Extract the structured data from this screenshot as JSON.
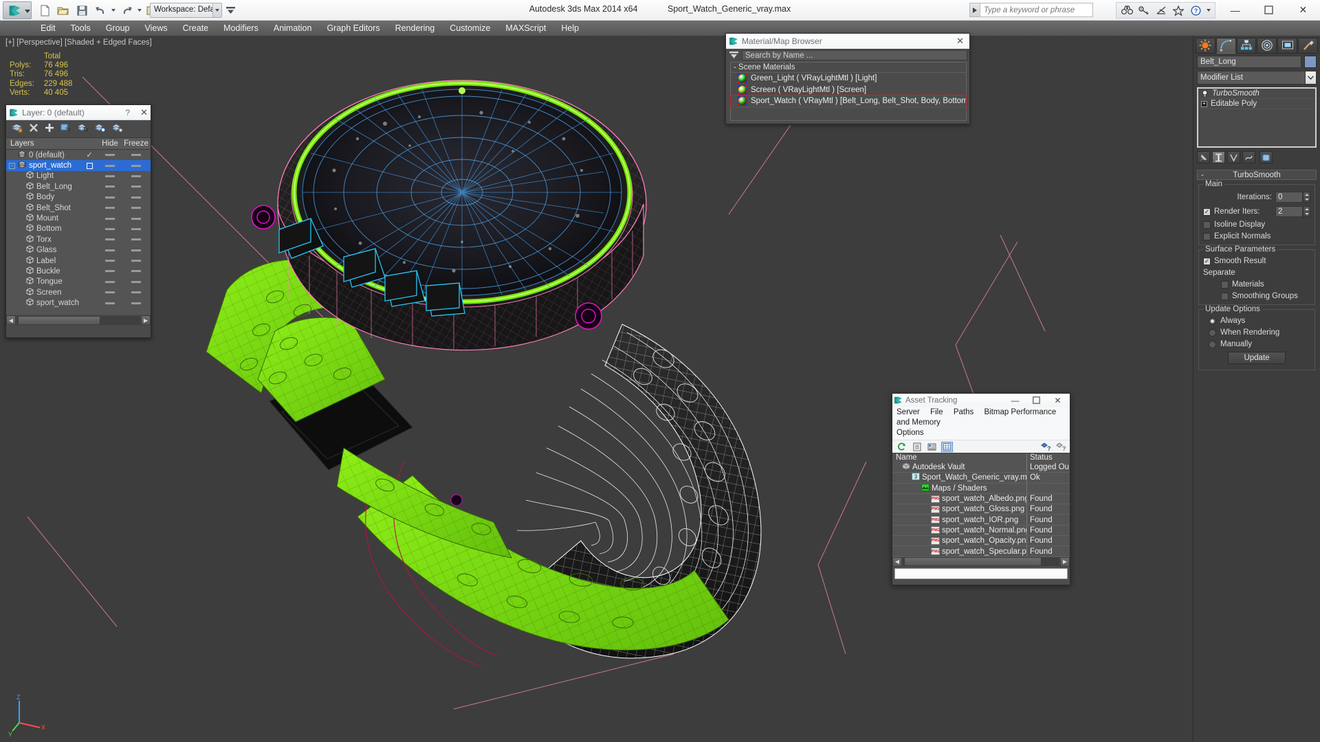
{
  "titlebar": {
    "workspace": "Workspace: Default",
    "app_title": "Autodesk 3ds Max  2014 x64",
    "file_title": "Sport_Watch_Generic_vray.max",
    "search_placeholder": "Type a keyword or phrase",
    "quick_access": [
      "new-icon",
      "open-icon",
      "save-icon",
      "undo-icon",
      "redo-icon",
      "set-project-folder-icon"
    ],
    "right_tools": [
      "binoculars-icon",
      "key-icon",
      "satellite-dish-icon",
      "star-icon",
      "help-icon"
    ],
    "window_controls": {
      "minimize": "—",
      "maximize": "☐",
      "close": "✕"
    }
  },
  "menubar": {
    "items": [
      "Edit",
      "Tools",
      "Group",
      "Views",
      "Create",
      "Modifiers",
      "Animation",
      "Graph Editors",
      "Rendering",
      "Customize",
      "MAXScript",
      "Help"
    ]
  },
  "viewport": {
    "label": "[+] [Perspective] [Shaded + Edged Faces]",
    "stats": {
      "col_header": "Total",
      "rows": [
        {
          "label": "Polys:",
          "value": "76 496"
        },
        {
          "label": "Tris:",
          "value": "76 496"
        },
        {
          "label": "Edges:",
          "value": "229 488"
        },
        {
          "label": "Verts:",
          "value": "40 405"
        }
      ]
    },
    "axis_labels": {
      "x": "X",
      "y": "Y",
      "z": "Z"
    }
  },
  "layer_dialog": {
    "title": "Layer: 0 (default)",
    "help": "?",
    "close": "✕",
    "toolbar_icons": [
      "create-new-layer-icon",
      "delete-layer-icon",
      "add-layer-icon",
      "select-objects-in-layer-icon",
      "select-highlighted-objects-icon",
      "highlight-selected-objects-icon",
      "layer-properties-icon"
    ],
    "columns": {
      "layers": "Layers",
      "hide": "Hide",
      "freeze": "Freeze"
    },
    "rows": [
      {
        "name": "0 (default)",
        "indent": 0,
        "icon": "layer-icon",
        "state": "check",
        "selected": false
      },
      {
        "name": "sport_watch",
        "indent": 0,
        "icon": "layer-icon",
        "state": "box",
        "selected": true,
        "expander": "-"
      },
      {
        "name": "Light",
        "indent": 1,
        "icon": "object-icon",
        "state": "",
        "selected": false
      },
      {
        "name": "Belt_Long",
        "indent": 1,
        "icon": "object-icon",
        "state": "",
        "selected": false
      },
      {
        "name": "Body",
        "indent": 1,
        "icon": "object-icon",
        "state": "",
        "selected": false
      },
      {
        "name": "Belt_Shot",
        "indent": 1,
        "icon": "object-icon",
        "state": "",
        "selected": false
      },
      {
        "name": "Mount",
        "indent": 1,
        "icon": "object-icon",
        "state": "",
        "selected": false
      },
      {
        "name": "Bottom",
        "indent": 1,
        "icon": "object-icon",
        "state": "",
        "selected": false
      },
      {
        "name": "Torx",
        "indent": 1,
        "icon": "object-icon",
        "state": "",
        "selected": false
      },
      {
        "name": "Glass",
        "indent": 1,
        "icon": "object-icon",
        "state": "",
        "selected": false
      },
      {
        "name": "Label",
        "indent": 1,
        "icon": "object-icon",
        "state": "",
        "selected": false
      },
      {
        "name": "Buckle",
        "indent": 1,
        "icon": "object-icon",
        "state": "",
        "selected": false
      },
      {
        "name": "Tongue",
        "indent": 1,
        "icon": "object-icon",
        "state": "",
        "selected": false
      },
      {
        "name": "Screen",
        "indent": 1,
        "icon": "object-icon",
        "state": "",
        "selected": false
      },
      {
        "name": "sport_watch",
        "indent": 1,
        "icon": "object-icon",
        "state": "",
        "selected": false
      }
    ]
  },
  "material_browser": {
    "title": "Material/Map Browser",
    "close": "✕",
    "search_value": "Search by Name ...",
    "group": "-  Scene Materials",
    "materials": [
      {
        "name": "Green_Light  ( VRayLightMtl )  [Light]",
        "color": "#22e022",
        "selected": false
      },
      {
        "name": "Screen  ( VRayLightMtl )  [Screen]",
        "color": "#8ee622",
        "selected": false
      },
      {
        "name": "Sport_Watch  ( VRayMtl )  [Belt_Long, Belt_Shot, Body, Bottom, Buckle,..",
        "color": "#56c41e",
        "selected": true
      }
    ]
  },
  "command_panel": {
    "tabs": [
      "create-tab-icon",
      "modify-tab-icon",
      "hierarchy-tab-icon",
      "motion-tab-icon",
      "display-tab-icon",
      "utilities-tab-icon"
    ],
    "active_tab_index": 1,
    "object_name": "Belt_Long",
    "object_color": "#7d98c4",
    "modifier_list_label": "Modifier List",
    "stack": [
      {
        "label": "TurboSmooth",
        "italic": true,
        "icon": "lightbulb-icon"
      },
      {
        "label": "Editable Poly",
        "italic": false,
        "icon": "plus-box-icon"
      }
    ],
    "stack_tools": [
      "pin-stack-icon",
      "show-end-result-icon",
      "make-unique-icon",
      "remove-modifier-icon",
      "configure-modifier-sets-icon"
    ],
    "rollout": {
      "title": "TurboSmooth",
      "minus": "-",
      "main": {
        "legend": "Main",
        "iterations_label": "Iterations:",
        "iterations_value": "0",
        "render_iters_label": "Render Iters:",
        "render_iters_value": "2",
        "render_iters_checked": true,
        "isoline_label": "Isoline Display",
        "isoline_checked": false,
        "explicit_label": "Explicit Normals",
        "explicit_checked": false
      },
      "surface": {
        "legend": "Surface Parameters",
        "smooth_result_label": "Smooth Result",
        "smooth_result_checked": true,
        "separate_label": "Separate",
        "materials_label": "Materials",
        "materials_checked": false,
        "smoothing_groups_label": "Smoothing Groups",
        "smoothing_groups_checked": false
      },
      "update": {
        "legend": "Update Options",
        "options": [
          "Always",
          "When Rendering",
          "Manually"
        ],
        "selected_index": 0,
        "button": "Update"
      }
    }
  },
  "asset_tracking": {
    "title": "Asset Tracking",
    "window_controls": {
      "minimize": "—",
      "maximize": "☐",
      "close": "✕"
    },
    "menu": [
      "Server",
      "File",
      "Paths",
      "Bitmap Performance and Memory",
      "Options"
    ],
    "toolbar_icons": [
      "refresh-icon",
      "list-view-icon",
      "detail-view-icon",
      "grid-view-icon",
      "add-help-icon",
      "help-icon"
    ],
    "columns": {
      "name": "Name",
      "status": "Status"
    },
    "rows": [
      {
        "name": "Autodesk Vault",
        "indent": 1,
        "icon": "vault-icon",
        "status": "Logged Ou"
      },
      {
        "name": "Sport_Watch_Generic_vray.max",
        "indent": 2,
        "icon": "max-file-icon",
        "status": "Ok"
      },
      {
        "name": "Maps / Shaders",
        "indent": 3,
        "icon": "maps-icon",
        "status": ""
      },
      {
        "name": "sport_watch_Albedo.png",
        "indent": 4,
        "icon": "png-icon",
        "status": "Found"
      },
      {
        "name": "sport_watch_Gloss.png",
        "indent": 4,
        "icon": "png-icon",
        "status": "Found"
      },
      {
        "name": "sport_watch_IOR.png",
        "indent": 4,
        "icon": "png-icon",
        "status": "Found"
      },
      {
        "name": "sport_watch_Normal.png",
        "indent": 4,
        "icon": "png-icon",
        "status": "Found"
      },
      {
        "name": "sport_watch_Opacity.png",
        "indent": 4,
        "icon": "png-icon",
        "status": "Found"
      },
      {
        "name": "sport_watch_Specular.png",
        "indent": 4,
        "icon": "png-icon",
        "status": "Found"
      }
    ]
  },
  "colors": {
    "accent_green": "#7cf000",
    "wire_white": "#ffffff",
    "wire_pink": "#ff7dbd",
    "wire_cyan": "#27c6f5",
    "wire_magenta": "#e013c4",
    "viewport_bg": "#3d3d3d",
    "stats_text": "#d8c24a",
    "selection_blue": "#2b6cd4"
  }
}
